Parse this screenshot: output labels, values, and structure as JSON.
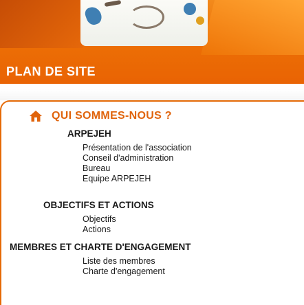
{
  "banner": {
    "title": "PLAN DE SITE"
  },
  "section": {
    "title": "QUI SOMMES-NOUS ?",
    "icon": "home-icon",
    "accent_color": "#e0640c"
  },
  "groups": [
    {
      "title": "ARPEJEH",
      "items": [
        "Présentation de l'association",
        "Conseil d'administration",
        "Bureau",
        "Equipe ARPEJEH"
      ]
    },
    {
      "title": "OBJECTIFS ET ACTIONS",
      "items": [
        "Objectifs",
        "Actions"
      ]
    },
    {
      "title": "MEMBRES ET CHARTE D'ENGAGEMENT",
      "items": [
        "Liste des membres",
        "Charte d'engagement"
      ]
    }
  ]
}
